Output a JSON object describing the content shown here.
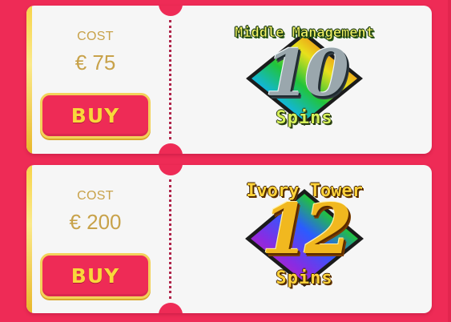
{
  "colors": {
    "background": "#ee2b56",
    "ticket": "#f6f6f6",
    "gold": "#f7d44a",
    "cost_text": "#c8a24a",
    "buy_text": "#f9d73b"
  },
  "packages": [
    {
      "cost_label": "COST",
      "price": "€ 75",
      "buy_label": "BUY",
      "prize_title": "Middle Management",
      "spin_count": "10",
      "spins_label": "Spins",
      "badge_icon": "rainbow-diamond-icon"
    },
    {
      "cost_label": "COST",
      "price": "€ 200",
      "buy_label": "BUY",
      "prize_title": "Ivory Tower",
      "spin_count": "12",
      "spins_label": "Spins",
      "badge_icon": "rainbow-diamond-icon"
    }
  ]
}
